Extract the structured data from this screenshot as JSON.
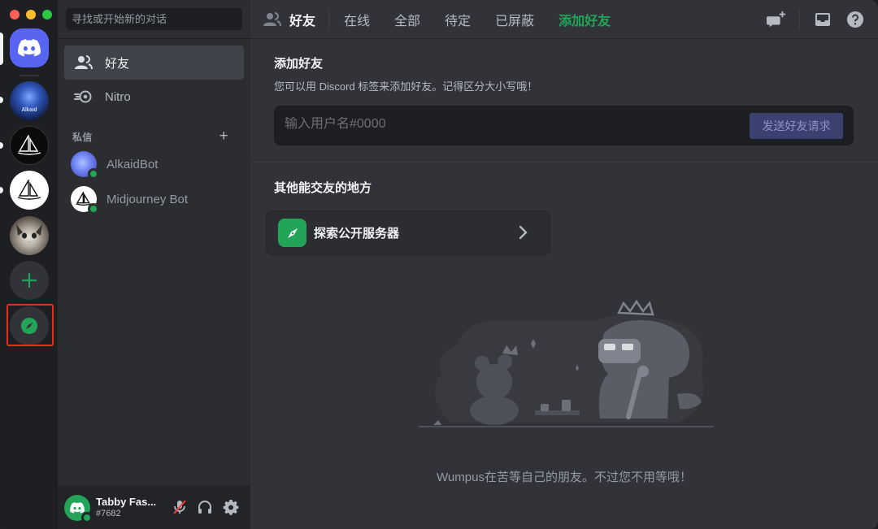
{
  "window": {
    "traffic_lights": [
      "close",
      "minimize",
      "zoom"
    ]
  },
  "rail": {
    "servers": [
      {
        "name": "home",
        "icon": "discord-logo-icon",
        "color": "#5865f2"
      },
      {
        "name": "alkaid",
        "label": "Alkaid",
        "color": "#1c3f8a"
      },
      {
        "name": "midjourney-dark",
        "icon": "sailboat-icon",
        "color": "#0c0c0c"
      },
      {
        "name": "midjourney-light",
        "icon": "sailboat-icon",
        "color": "#ffffff"
      },
      {
        "name": "cat-server",
        "icon": "cat-photo-icon",
        "color": "#5a5650"
      }
    ],
    "add_server_icon": "plus-icon",
    "explore_icon": "compass-icon",
    "accent": "#23a559",
    "highlight_color": "#e0301e"
  },
  "sidebar": {
    "search_placeholder": "寻找或开始新的对话",
    "nav": [
      {
        "label": "好友",
        "icon": "friends-icon",
        "active": true
      },
      {
        "label": "Nitro",
        "icon": "nitro-icon",
        "active": false
      }
    ],
    "dm_header": "私信",
    "dms": [
      {
        "name": "AlkaidBot",
        "status": "online"
      },
      {
        "name": "Midjourney Bot",
        "status": "online"
      }
    ]
  },
  "user": {
    "name": "Tabby Fas...",
    "tag": "#7682",
    "controls": [
      "mic-muted-icon",
      "headphones-icon",
      "gear-icon"
    ]
  },
  "topbar": {
    "title": "好友",
    "tabs": [
      "在线",
      "全部",
      "待定",
      "已屏蔽"
    ],
    "add_friend_tab": "添加好友",
    "right_icons": [
      "new-group-dm-icon",
      "inbox-icon",
      "help-icon"
    ]
  },
  "add_friend": {
    "title": "添加好友",
    "description": "您可以用 Discord 标签来添加好友。记得区分大小写哦！",
    "input_placeholder": "输入用户名#0000",
    "input_value": "",
    "send_button": "发送好友请求"
  },
  "other_places": {
    "title": "其他能交友的地方",
    "explore_label": "探索公开服务器"
  },
  "empty_state": {
    "caption": "Wumpus在苦等自己的朋友。不过您不用等哦！"
  }
}
